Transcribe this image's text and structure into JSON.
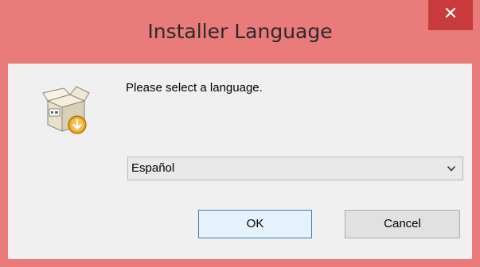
{
  "window": {
    "title": "Installer Language",
    "close_glyph": "✕",
    "frame_color": "#e97b7b",
    "close_color": "#c93a3a"
  },
  "dialog": {
    "icon": "installer-box-icon",
    "prompt": "Please select a language.",
    "language_select": {
      "selected": "Español",
      "icon": "chevron-down-icon"
    },
    "ok_label": "OK",
    "cancel_label": "Cancel"
  }
}
